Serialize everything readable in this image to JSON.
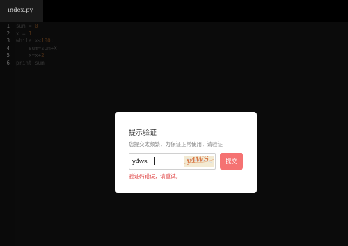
{
  "tab": {
    "label": "index.py"
  },
  "editor": {
    "line_numbers": [
      "1",
      "2",
      "3",
      "4",
      "5",
      "6"
    ],
    "lines": [
      [
        {
          "text": "sum",
          "kind": "var"
        },
        {
          "text": " = ",
          "kind": "op"
        },
        {
          "text": "0",
          "kind": "num"
        }
      ],
      [
        {
          "text": "x",
          "kind": "var"
        },
        {
          "text": " = ",
          "kind": "op"
        },
        {
          "text": "1",
          "kind": "num"
        }
      ],
      [
        {
          "text": "while",
          "kind": "kw"
        },
        {
          "text": " x<",
          "kind": "op"
        },
        {
          "text": "100",
          "kind": "num"
        },
        {
          "text": ":",
          "kind": "op"
        }
      ],
      [
        {
          "text": "    sum=sum+X",
          "kind": "var"
        }
      ],
      [
        {
          "text": "    x=x+",
          "kind": "var"
        },
        {
          "text": "2",
          "kind": "num"
        }
      ],
      [
        {
          "text": "print",
          "kind": "kw"
        },
        {
          "text": " sum",
          "kind": "var"
        }
      ]
    ]
  },
  "dialog": {
    "title": "提示验证",
    "description": "您提交太频繁，为保证正常使用，请验证",
    "input_value": "y4ws",
    "captcha_text": "y4WS",
    "submit_label": "提交",
    "error_message": "验证码错误，请重试。"
  },
  "colors": {
    "accent_button": "#f57272",
    "error_text": "#e04545",
    "number_token": "#7a4a22",
    "captcha_text": "#d87a4a"
  }
}
